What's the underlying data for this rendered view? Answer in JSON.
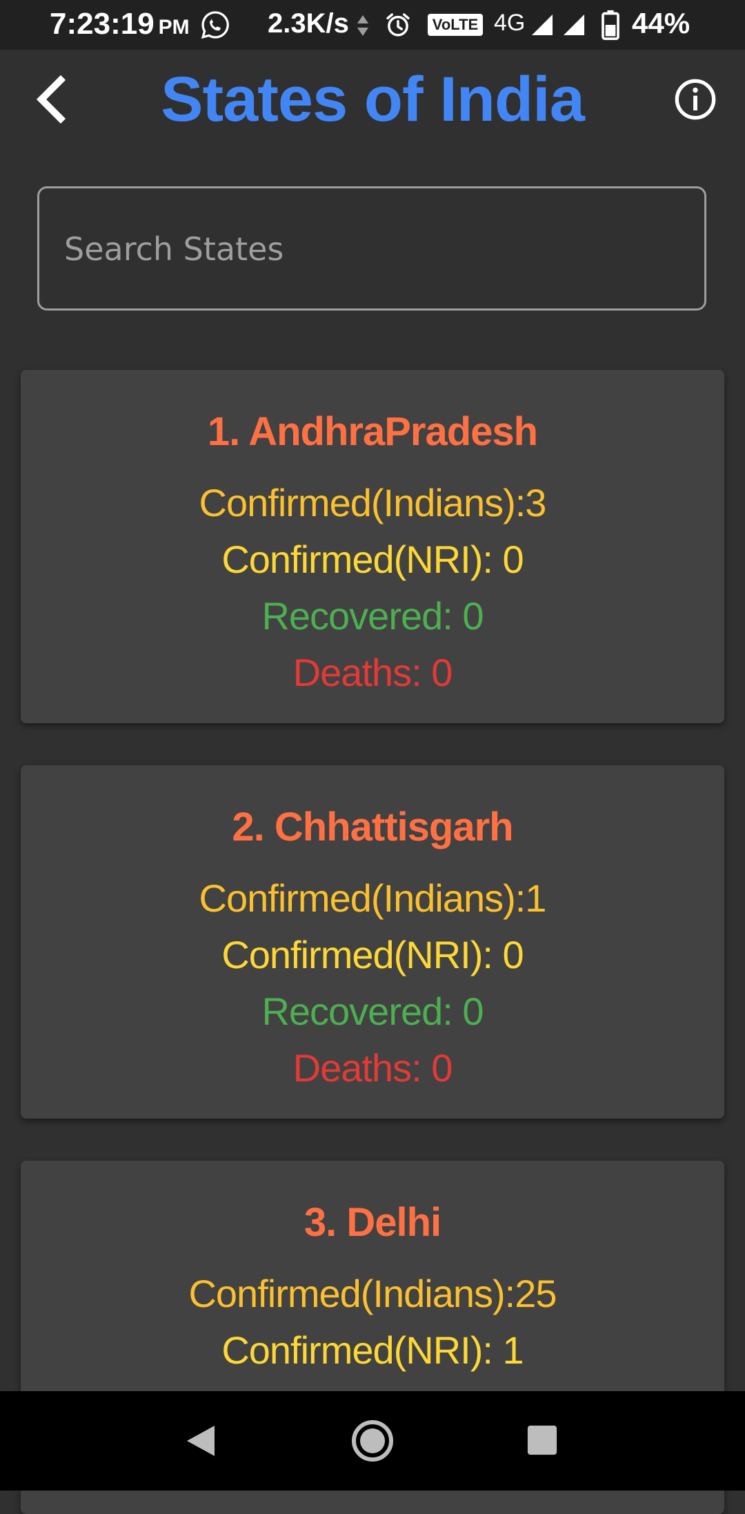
{
  "status_bar": {
    "time": "7:23:19",
    "ampm": "PM",
    "net_speed": "2.3K/s",
    "volte": "VoLTE",
    "network": "4G",
    "battery": "44%"
  },
  "app_bar": {
    "title": "States of India"
  },
  "search": {
    "placeholder": "Search States",
    "value": ""
  },
  "states": [
    {
      "heading": "1.  AndhraPradesh",
      "confirmed_indians": "Confirmed(Indians):3",
      "confirmed_nri": "Confirmed(NRI): 0",
      "recovered": "Recovered: 0",
      "deaths": "Deaths: 0"
    },
    {
      "heading": "2.  Chhattisgarh",
      "confirmed_indians": "Confirmed(Indians):1",
      "confirmed_nri": "Confirmed(NRI): 0",
      "recovered": "Recovered: 0",
      "deaths": "Deaths: 0"
    },
    {
      "heading": "3.  Delhi",
      "confirmed_indians": "Confirmed(Indians):25",
      "confirmed_nri": "Confirmed(NRI): 1",
      "recovered": "",
      "deaths": ""
    }
  ],
  "colors": {
    "title": "#4285f4",
    "state_name": "#ff7043",
    "confirmed": "#fbc02d",
    "recovered": "#4caf50",
    "deaths": "#e53935"
  }
}
